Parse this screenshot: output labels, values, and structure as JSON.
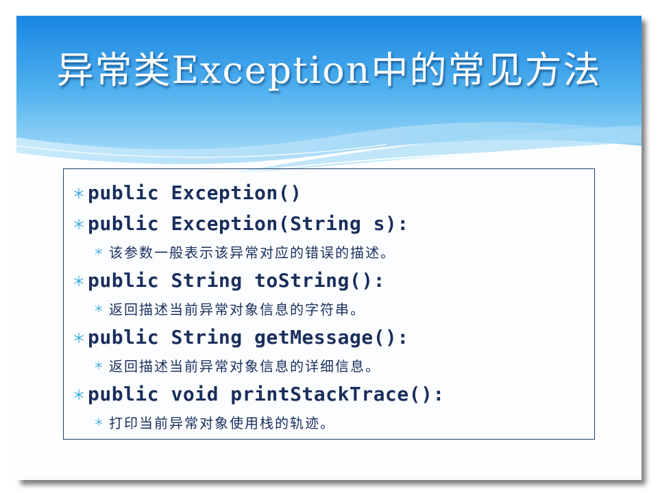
{
  "slide": {
    "title": "异常类Exception中的常见方法",
    "items": [
      {
        "level": 1,
        "text": "public Exception()"
      },
      {
        "level": 1,
        "text": "public Exception(String s):"
      },
      {
        "level": 2,
        "text": "该参数一般表示该异常对应的错误的描述。"
      },
      {
        "level": 1,
        "text": "public String toString():"
      },
      {
        "level": 2,
        "text": "返回描述当前异常对象信息的字符串。"
      },
      {
        "level": 1,
        "text": "public String getMessage():"
      },
      {
        "level": 2,
        "text": "返回描述当前异常对象信息的详细信息。"
      },
      {
        "level": 1,
        "text": "public void printStackTrace():"
      },
      {
        "level": 2,
        "text": "打印当前异常对象使用栈的轨迹。"
      }
    ],
    "bullet_glyph": "＊",
    "colors": {
      "header_top": "#1e8fe6",
      "header_bottom": "#8fd0f6",
      "text": "#1a2e5c",
      "bullet": "#34a9d6",
      "box_border": "#1e3c6e"
    }
  }
}
